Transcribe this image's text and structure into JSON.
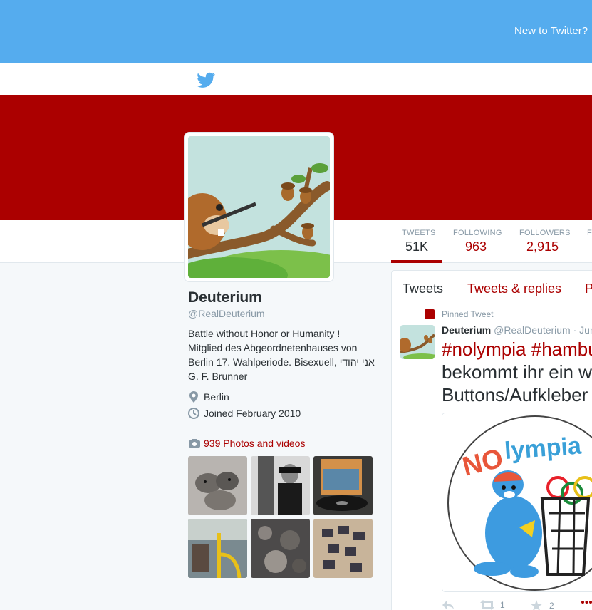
{
  "topbar": {
    "new_to_twitter": "New to Twitter?"
  },
  "brand_color": "#ab0000",
  "stats": {
    "tweets": {
      "label": "TWEETS",
      "value": "51K"
    },
    "following": {
      "label": "FOLLOWING",
      "value": "963"
    },
    "followers": {
      "label": "FOLLOWERS",
      "value": "2,915"
    },
    "favorites": {
      "label": "F"
    }
  },
  "profile": {
    "name": "Deuterium",
    "handle": "@RealDeuterium",
    "bio": "Battle without Honor or Humanity ! Mitglied des Abgeordnetenhauses von Berlin 17. Wahlperiode. Bisexuell, אני יהודי G. F. Brunner",
    "location": "Berlin",
    "joined": "Joined February 2010",
    "photos_link": "939 Photos and videos"
  },
  "timeline": {
    "tabs": [
      "Tweets",
      "Tweets & replies",
      "P"
    ],
    "pinned_label": "Pinned Tweet",
    "tweet": {
      "author": "Deuterium",
      "handle": "@RealDeuterium",
      "date": "· Jun",
      "tag1": "#nolympia",
      "tag2": "#hambu",
      "line2": "bekommt ihr ein w",
      "line3": "Buttons/Aufkleber",
      "image_text": "NOlympia",
      "retweets": "1",
      "favorites": "2"
    }
  }
}
